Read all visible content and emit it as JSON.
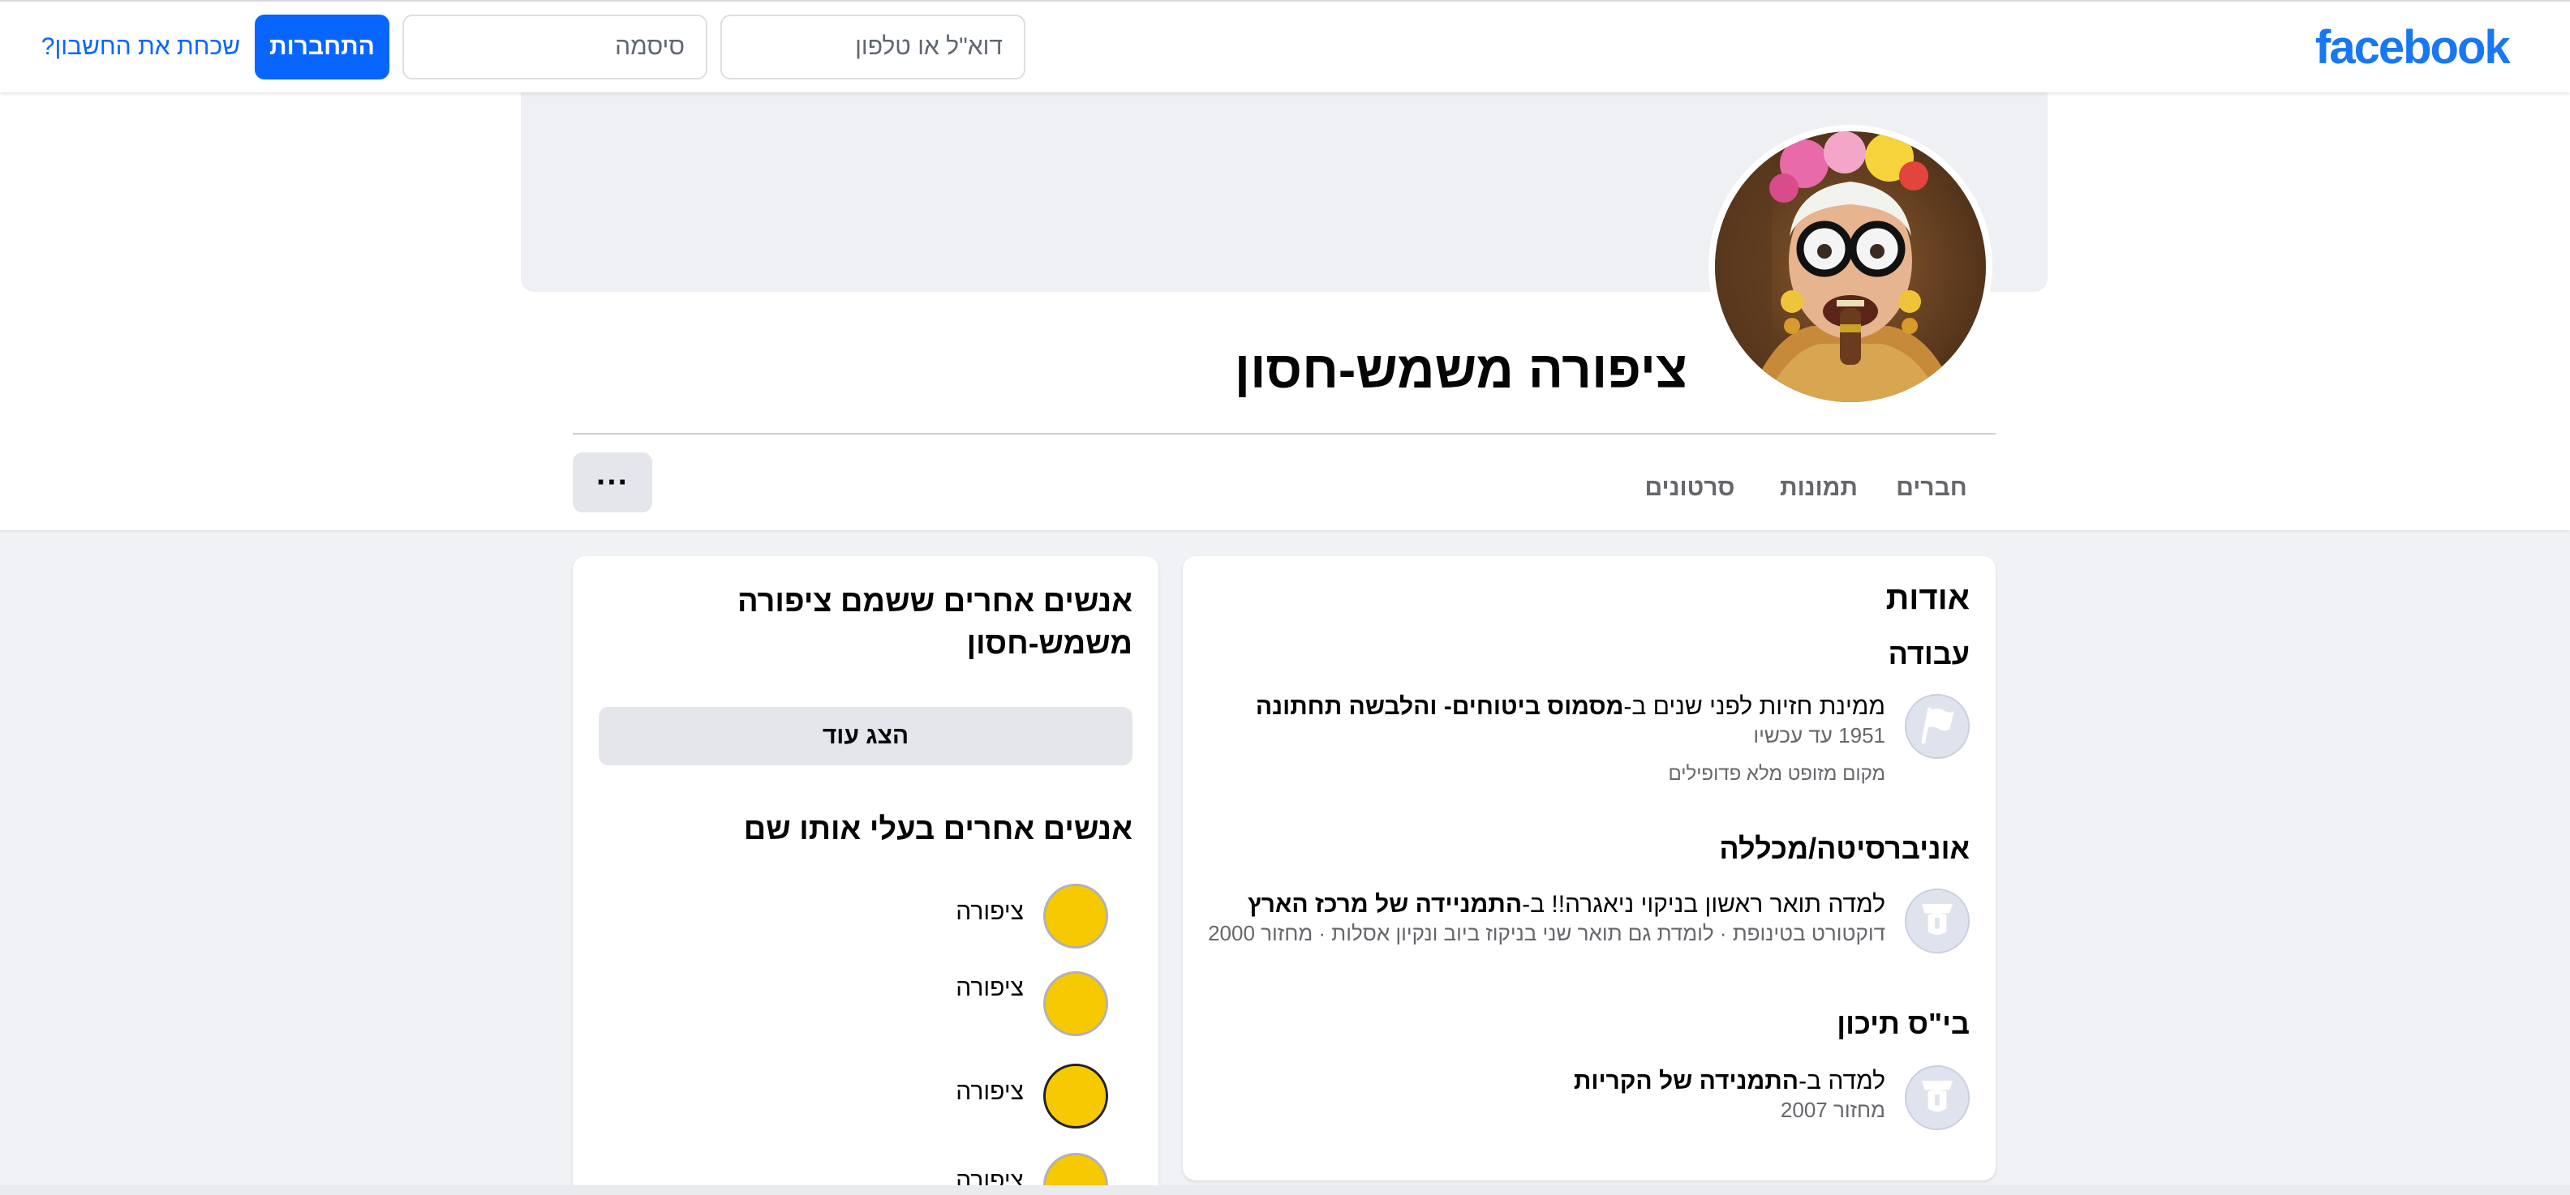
{
  "topbar": {
    "logo": "facebook",
    "email_placeholder": "דוא\"ל או טלפון",
    "password_placeholder": "סיסמה",
    "login_label": "התחברות",
    "forgot_label": "שכחת את החשבון?"
  },
  "profile": {
    "name": "ציפורה משמש-חסון",
    "tabs": [
      "חברים",
      "תמונות",
      "סרטונים"
    ],
    "more_label": "···"
  },
  "about": {
    "title": "אודות",
    "work": {
      "heading": "עבודה",
      "line_prefix": "ממינת חזיות לפני שנים ב-",
      "line_bold": "מסמוס ביטוחים- והלבשה תחתונה",
      "years": "1951 עד עכשיו",
      "location": "מקום מזופט מלא פדופילים"
    },
    "university": {
      "heading": "אוניברסיטה/מכללה",
      "line_prefix": "למדה תואר ראשון בניקוי ניאגרה!! ב-",
      "line_bold": "התמניידה של מרכז הארץ",
      "details": "דוקטורט בטינופת · לומדת גם תואר שני בניקוז ביוב ונקיון אסלות · מחזור 2000"
    },
    "highschool": {
      "heading": "בי\"ס תיכון",
      "line_prefix": "למדה ב-",
      "line_bold": "התמנידה של הקריות",
      "details": "מחזור 2007"
    }
  },
  "people": {
    "title": "אנשים אחרים ששמם ציפורה משמש-חסון",
    "show_more": "הצג עוד",
    "same_name_title": "אנשים אחרים בעלי אותו שם",
    "items": [
      {
        "name": "ציפורה"
      },
      {
        "name": "ציפורה"
      },
      {
        "name": "ציפורה"
      },
      {
        "name": "ציפורה"
      }
    ]
  },
  "colors": {
    "brand": "#1877f2",
    "button_blue": "#0866ff",
    "page_bg": "#f0f2f5",
    "avatar_yellow": "#f7c900"
  }
}
